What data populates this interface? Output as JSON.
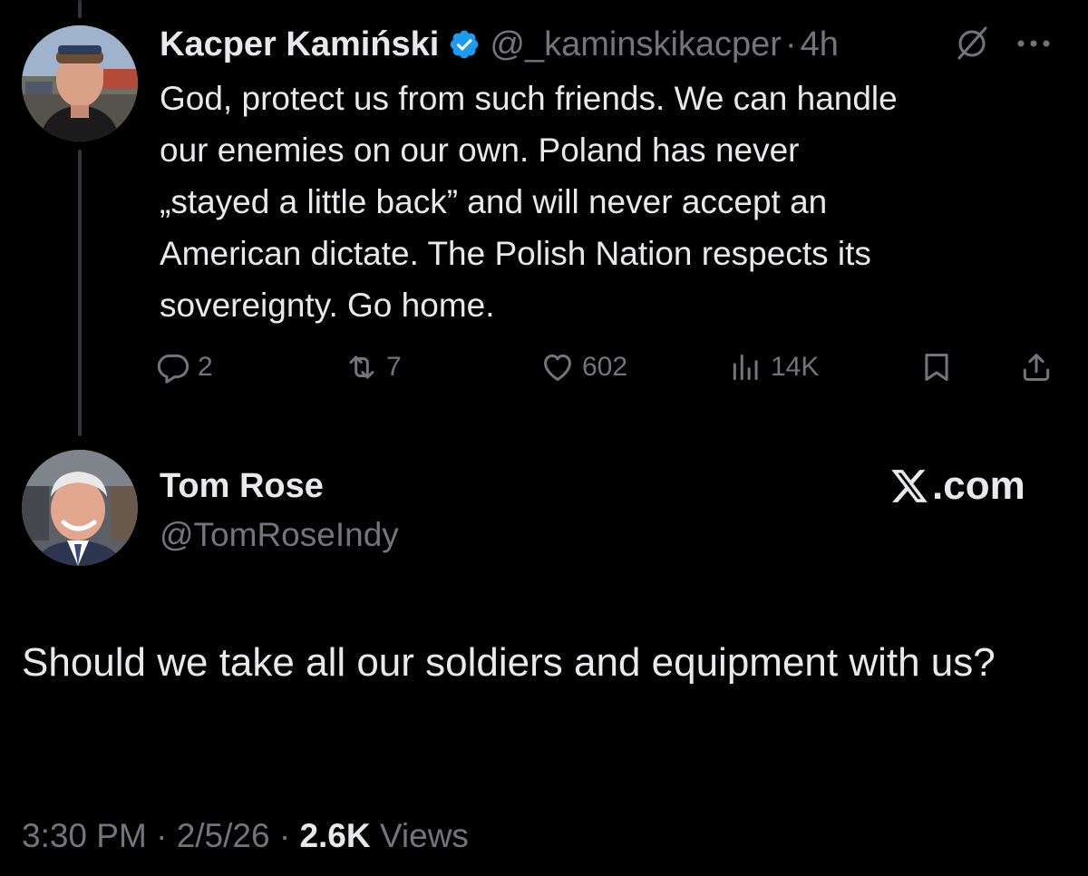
{
  "original_tweet": {
    "display_name": "Kacper Kamiński",
    "handle": "@_kaminskikacper",
    "separator": "·",
    "age": "4h",
    "text_lines": [
      "God, protect us from such friends. We can handle",
      "our enemies on our own. Poland has never",
      "„stayed a little back” and will never accept an",
      "American dictate. The Polish Nation respects its",
      "sovereignty. Go home."
    ],
    "actions": {
      "replies": "2",
      "reposts": "7",
      "likes": "602",
      "views": "14K"
    }
  },
  "reply_tweet": {
    "display_name": "Tom Rose",
    "handle": "@TomRoseIndy",
    "text": "Should we take all our soldiers and equipment with us?",
    "time": "3:30 PM",
    "separator": "·",
    "date": "2/5/26",
    "views_count": "2.6K",
    "views_label": "Views"
  },
  "watermark": {
    "label": ".com"
  },
  "icons": {
    "verified": "verified-badge-icon",
    "grok": "grok-icon",
    "more": "more-icon",
    "reply": "reply-icon",
    "retweet": "retweet-icon",
    "like": "heart-icon",
    "views": "views-icon",
    "bookmark": "bookmark-icon",
    "share": "share-icon",
    "x_logo": "x-logo-icon"
  },
  "colors": {
    "background": "#000000",
    "text_primary": "#e7e9ea",
    "text_secondary": "#71767b",
    "verified_blue": "#1d9bf0",
    "thread_line": "#333639"
  }
}
